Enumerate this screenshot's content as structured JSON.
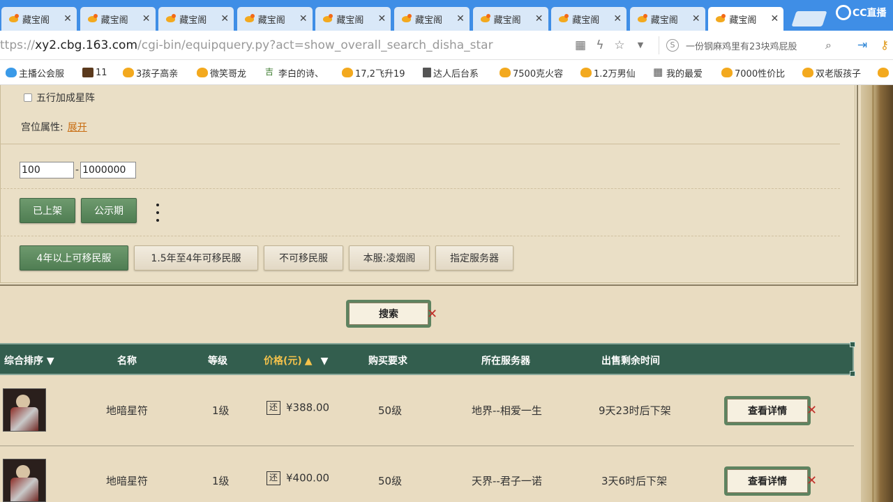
{
  "browser": {
    "tabs": [
      {
        "title": "藏宝阁"
      },
      {
        "title": "藏宝阁"
      },
      {
        "title": "藏宝阁"
      },
      {
        "title": "藏宝阁"
      },
      {
        "title": "藏宝阁"
      },
      {
        "title": "藏宝阁"
      },
      {
        "title": "藏宝阁"
      },
      {
        "title": "藏宝阁"
      },
      {
        "title": "藏宝阁"
      },
      {
        "title": "藏宝阁",
        "active": true
      }
    ],
    "close_glyph": "✕",
    "brand_label": "CC直播",
    "url_prefix": "ttps://",
    "url_host": "xy2.cbg.163.com",
    "url_path": "/cgi-bin/equipquery.py?act=show_overall_search_disha_star",
    "search_text": "一份钢麻鸡里有23块鸡屁股",
    "icons": {
      "qr": "qr-icon",
      "lightning": "lightning-icon",
      "star": "star-icon",
      "search": "magnifier-icon"
    }
  },
  "bookmarks": [
    {
      "label": "主播公会服",
      "icon": "blue"
    },
    {
      "label": "11",
      "icon": "dark"
    },
    {
      "label": "3孩子高亲",
      "icon": "fav"
    },
    {
      "label": "微笑哥龙",
      "icon": "fav"
    },
    {
      "label": "李白的诗、",
      "icon": "leaf"
    },
    {
      "label": "17,2飞升19",
      "icon": "fav"
    },
    {
      "label": "达人后台系",
      "icon": "doc"
    },
    {
      "label": "7500克火容",
      "icon": "fav"
    },
    {
      "label": "1.2万男仙",
      "icon": "fav"
    },
    {
      "label": "我的最爱",
      "icon": "grid"
    },
    {
      "label": "7000性价比",
      "icon": "fav"
    },
    {
      "label": "双老版孩子",
      "icon": "fav"
    }
  ],
  "filters": {
    "wuxing_checkbox_label": "五行加成星阵",
    "gongwei_label": "宫位属性:",
    "gongwei_toggle": "展开",
    "price_min": "100",
    "price_sep": "-",
    "price_max": "1000000",
    "status_buttons": [
      {
        "label": "已上架",
        "selected": true
      },
      {
        "label": "公示期",
        "selected": true
      }
    ],
    "server_buttons": [
      {
        "label": "4年以上可移民服",
        "selected": true
      },
      {
        "label": "1.5年至4年可移民服",
        "selected": false
      },
      {
        "label": "不可移民服",
        "selected": false
      },
      {
        "label": "本服:凌烟阁",
        "selected": false
      },
      {
        "label": "指定服务器",
        "selected": false
      }
    ],
    "search_button": "搜索"
  },
  "table": {
    "headers": {
      "sort": "综合排序",
      "name": "名称",
      "level": "等级",
      "price": "价格(元)",
      "requirement": "购买要求",
      "server": "所在服务器",
      "remaining": "出售剩余时间"
    },
    "sort_glyph": "▼",
    "price_up_glyph": "🠕",
    "price_down_glyph": "🠗",
    "rows": [
      {
        "name": "地暗星符",
        "level": "1级",
        "return_icon": "还",
        "price": "¥388.00",
        "requirement": "50级",
        "server": "地界--相爱一生",
        "remaining": "9天23时后下架",
        "action": "查看详情"
      },
      {
        "name": "地暗星符",
        "level": "1级",
        "return_icon": "还",
        "price": "¥400.00",
        "requirement": "50级",
        "server": "天界--君子一诺",
        "remaining": "3天6时后下架",
        "action": "查看详情"
      }
    ]
  },
  "colors": {
    "header_green": "#335e4e",
    "price_gold": "#f4c24b",
    "button_green": "#5e8360",
    "link_orange": "#c86d12",
    "tab_bar_blue": "#3f8ee6"
  }
}
